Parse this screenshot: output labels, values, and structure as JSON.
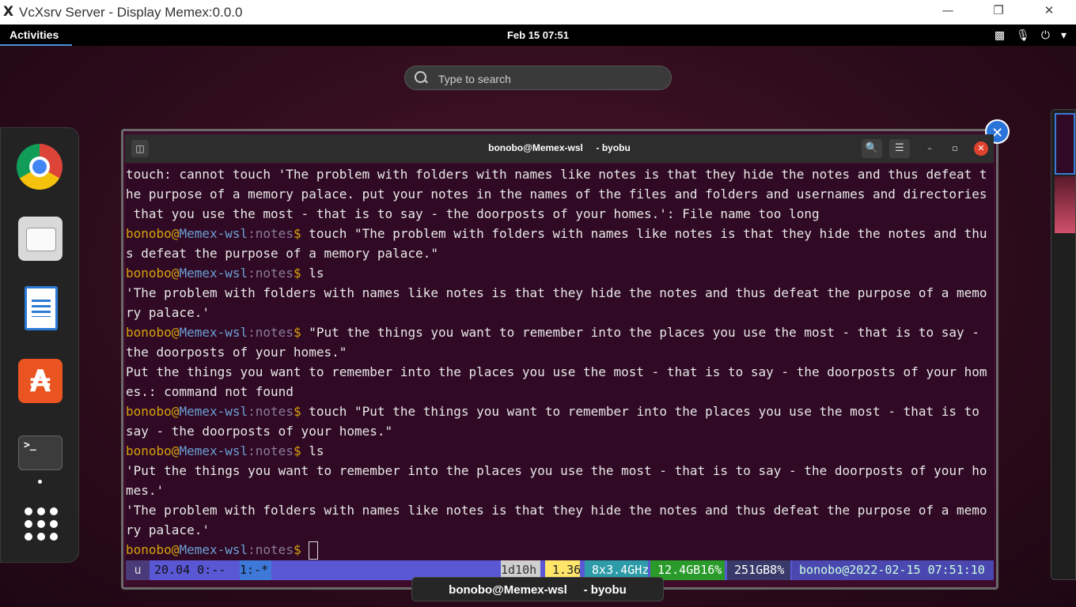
{
  "window": {
    "app_icon": "X",
    "title": "VcXsrv Server - Display Memex:0.0.0",
    "minimize": "—",
    "maximize": "❐",
    "close": "✕"
  },
  "topbar": {
    "activities": "Activities",
    "clock": "Feb 15  07:51",
    "tray_icons": [
      "network-icon",
      "microphone-icon",
      "power-icon",
      "chevron-down-icon"
    ]
  },
  "search": {
    "placeholder": "Type to search"
  },
  "dock": {
    "items": [
      "chrome",
      "files",
      "libreoffice-writer",
      "app-store",
      "terminal"
    ],
    "terminal_label": ">_"
  },
  "terminal": {
    "title": "bonobo@Memex-wsl     - byobu",
    "lines": [
      {
        "type": "output",
        "text": "touch: cannot touch 'The problem with folders with names like notes is that they hide the notes and thus defeat t"
      },
      {
        "type": "output",
        "text": "he purpose of a memory palace. put your notes in the names of the files and folders and usernames and directories"
      },
      {
        "type": "output",
        "text": " that you use the most - that is to say - the doorposts of your homes.': File name too long"
      },
      {
        "type": "prompt",
        "user": "bonobo",
        "at": "@",
        "host": "Memex-wsl",
        "colon": ":",
        "path": "notes",
        "dollar": "$",
        "cmd": " touch \"The problem with folders with names like notes is that they hide the notes and thu"
      },
      {
        "type": "output",
        "text": "s defeat the purpose of a memory palace.\""
      },
      {
        "type": "prompt",
        "user": "bonobo",
        "at": "@",
        "host": "Memex-wsl",
        "colon": ":",
        "path": "notes",
        "dollar": "$",
        "cmd": " ls"
      },
      {
        "type": "output",
        "text": "'The problem with folders with names like notes is that they hide the notes and thus defeat the purpose of a memo"
      },
      {
        "type": "output",
        "text": "ry palace.'"
      },
      {
        "type": "prompt",
        "user": "bonobo",
        "at": "@",
        "host": "Memex-wsl",
        "colon": ":",
        "path": "notes",
        "dollar": "$",
        "cmd": " \"Put the things you want to remember into the places you use the most - that is to say -"
      },
      {
        "type": "output",
        "text": "the doorposts of your homes.\""
      },
      {
        "type": "output",
        "text": "Put the things you want to remember into the places you use the most - that is to say - the doorposts of your hom"
      },
      {
        "type": "output",
        "text": "es.: command not found"
      },
      {
        "type": "prompt",
        "user": "bonobo",
        "at": "@",
        "host": "Memex-wsl",
        "colon": ":",
        "path": "notes",
        "dollar": "$",
        "cmd": " touch \"Put the things you want to remember into the places you use the most - that is to"
      },
      {
        "type": "output",
        "text": "say - the doorposts of your homes.\""
      },
      {
        "type": "prompt",
        "user": "bonobo",
        "at": "@",
        "host": "Memex-wsl",
        "colon": ":",
        "path": "notes",
        "dollar": "$",
        "cmd": " ls"
      },
      {
        "type": "output",
        "text": "'Put the things you want to remember into the places you use the most - that is to say - the doorposts of your ho"
      },
      {
        "type": "output",
        "text": "mes.'"
      },
      {
        "type": "output",
        "text": "'The problem with folders with names like notes is that they hide the notes and thus defeat the purpose of a memo"
      },
      {
        "type": "output",
        "text": "ry palace.'"
      },
      {
        "type": "prompt",
        "user": "bonobo",
        "at": "@",
        "host": "Memex-wsl",
        "colon": ":",
        "path": "notes",
        "dollar": "$",
        "cmd": " ",
        "cursor": true
      }
    ]
  },
  "byobu": {
    "u": "u",
    "version": "20.04 0:--",
    "window": "1:-*",
    "uptime": "1d10h",
    "load": " 1.36",
    "cpu": " 8x3.4GHz",
    "mem": " 12.4GB16%",
    "disk": " 251GB8%",
    "datetime": " bonobo@2022-02-15 07:51:10"
  },
  "tooltip": "bonobo@Memex-wsl     - byobu",
  "colors": {
    "terminal_bg": "#300a24",
    "prompt_user": "#d6a10d",
    "prompt_host": "#6b9fd4",
    "accent": "#2a73d8"
  }
}
